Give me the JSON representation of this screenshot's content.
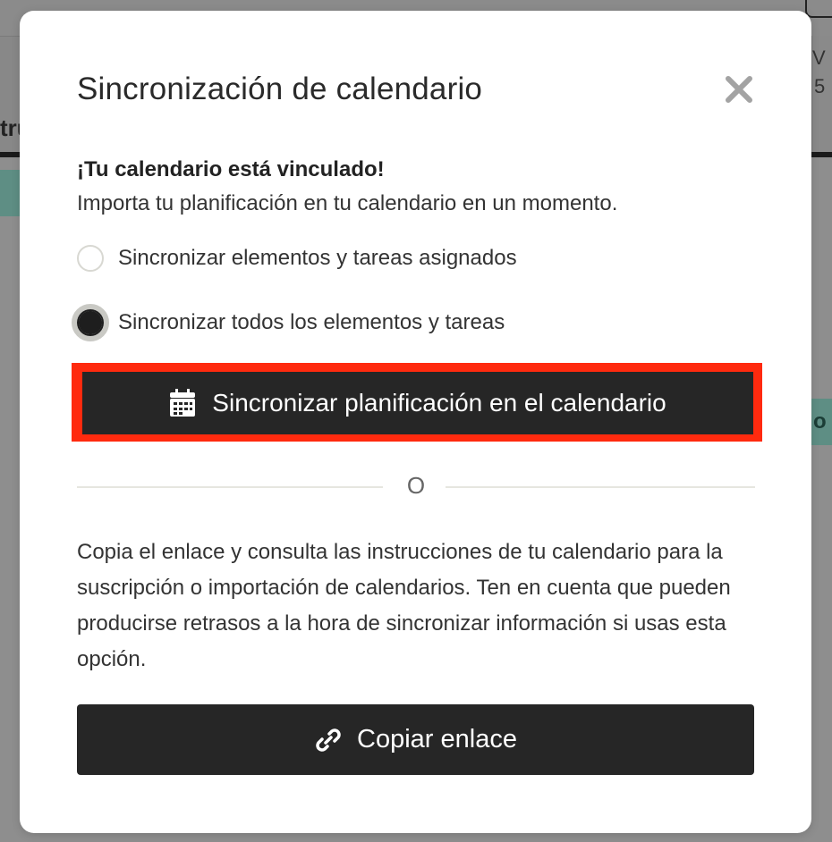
{
  "background": {
    "left_fragment": "tru",
    "right_fragments": [
      "V",
      "5"
    ],
    "right_teal_fragment": "o"
  },
  "modal": {
    "title": "Sincronización de calendario",
    "close_icon": "close-icon",
    "subheading": "¡Tu calendario está vinculado!",
    "description": "Importa tu planificación en tu calendario en un momento.",
    "options": [
      {
        "label": "Sincronizar elementos y tareas asignados",
        "checked": false
      },
      {
        "label": "Sincronizar todos los elementos y tareas",
        "checked": true
      }
    ],
    "sync_button": {
      "label": "Sincronizar planificación en el calendario",
      "icon": "calendar-icon",
      "highlight_color": "#ff2a0e"
    },
    "divider_text": "O",
    "instructions": "Copia el enlace y consulta las instrucciones de tu calendario para la suscripción o importación de calendarios. Ten en cuenta que pueden producirse retrasos a la hora de sincronizar información si usas esta opción.",
    "copy_button": {
      "label": "Copiar enlace",
      "icon": "link-icon"
    }
  },
  "colors": {
    "button_bg": "#262626",
    "overlay": "#8e8e8e",
    "accent_teal": "#5e8e84"
  }
}
